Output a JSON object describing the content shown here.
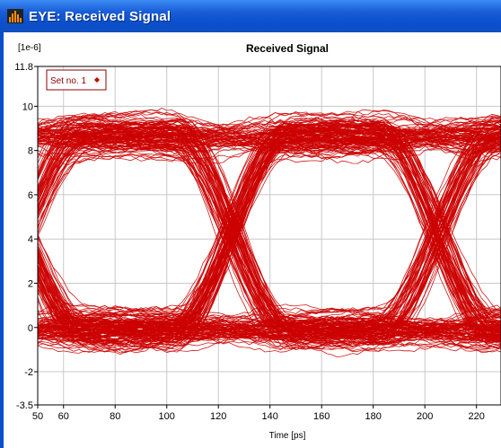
{
  "window": {
    "title": "EYE: Received Signal"
  },
  "chart_data": {
    "type": "line",
    "title": "Received Signal",
    "scale_label": "[1e-6]",
    "xlabel": "Time [ps]",
    "ylabel": "",
    "xlim": [
      50,
      230
    ],
    "ylim": [
      -3.5,
      11.8
    ],
    "x_ticks": [
      "50",
      "60",
      "80",
      "100",
      "120",
      "140",
      "160",
      "180",
      "200",
      "220"
    ],
    "y_ticks": [
      "11.8",
      "10",
      "8",
      "6",
      "4",
      "2",
      "0",
      "-2",
      "-3.5"
    ],
    "grid": true,
    "series": [
      {
        "name": "Set no. 1",
        "color": "#cc0000",
        "bit_period_ps": 80,
        "crossing_times_ps": [
          45,
          125,
          205
        ],
        "crossing_level": 4.2,
        "high_level": 8.7,
        "low_level": -0.1,
        "high_spread": [
          5.5,
          11.2
        ],
        "low_spread": [
          -2.8,
          3.2
        ],
        "eye_opening": [
          4.8,
          6.2
        ]
      }
    ],
    "legend": {
      "position": "top-left",
      "entries": [
        "Set no. 1"
      ]
    }
  }
}
